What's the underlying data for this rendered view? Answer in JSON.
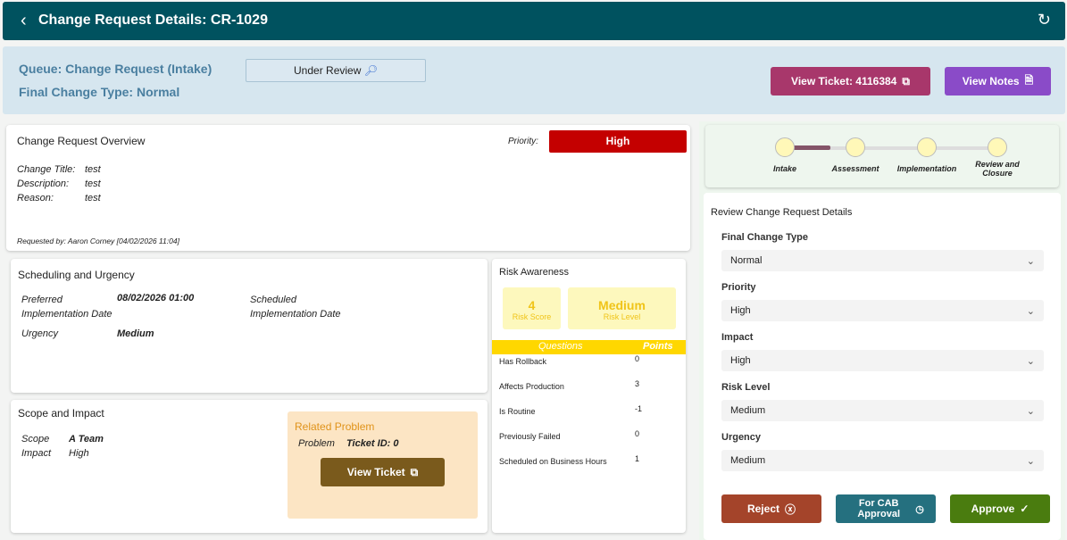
{
  "header": {
    "title": "Change Request Details: CR-1029",
    "back_icon": "‹",
    "refresh_icon": "↻"
  },
  "summary": {
    "queue": "Queue: Change Request (Intake)",
    "final_type": "Final Change Type: Normal",
    "status": "Under Review",
    "view_ticket": "View Ticket: 4116384",
    "view_notes": "View Notes"
  },
  "overview": {
    "title": "Change Request Overview",
    "priority_label": "Priority:",
    "priority": "High",
    "fields": [
      {
        "label": "Change Title:",
        "value": "test"
      },
      {
        "label": "Description:",
        "value": "test"
      },
      {
        "label": "Reason:",
        "value": "test"
      }
    ],
    "requested_by": "Requested by: Aaron Corney [04/02/2026 11:04]"
  },
  "scheduling": {
    "title": "Scheduling and Urgency",
    "preferred_label": "Preferred Implementation Date",
    "preferred_value": "08/02/2026 01:00",
    "scheduled_label": "Scheduled Implementation Date",
    "urgency_label": "Urgency",
    "urgency_value": "Medium"
  },
  "scope": {
    "title": "Scope and Impact",
    "scope_label": "Scope",
    "scope_value": "A Team",
    "impact_label": "Impact",
    "impact_value": "High",
    "related_title": "Related Problem",
    "problem_label": "Problem",
    "ticket_id": "Ticket ID: 0",
    "view_ticket": "View Ticket"
  },
  "risk": {
    "title": "Risk Awareness",
    "score": "4",
    "score_label": "Risk Score",
    "level": "Medium",
    "level_label": "Risk Level",
    "col_q": "Questions",
    "col_p": "Points",
    "rows": [
      {
        "q": "Has Rollback",
        "p": "0"
      },
      {
        "q": "Affects Production",
        "p": "3"
      },
      {
        "q": "Is Routine",
        "p": "-1"
      },
      {
        "q": "Previously Failed",
        "p": "0"
      },
      {
        "q": "Scheduled on Business Hours",
        "p": "1"
      }
    ]
  },
  "progress": {
    "steps": [
      "Intake",
      "Assessment",
      "Implementation",
      "Review and Closure"
    ],
    "current_step": 0,
    "fill_fraction_first_segment": 0.4
  },
  "review": {
    "title": "Review Change Request Details",
    "fields": [
      {
        "label": "Final Change Type",
        "value": "Normal"
      },
      {
        "label": "Priority",
        "value": "High"
      },
      {
        "label": "Impact",
        "value": "High"
      },
      {
        "label": "Risk Level",
        "value": "Medium"
      },
      {
        "label": "Urgency",
        "value": "Medium"
      }
    ],
    "reject": "Reject",
    "cab": "For CAB Approval",
    "approve": "Approve"
  }
}
